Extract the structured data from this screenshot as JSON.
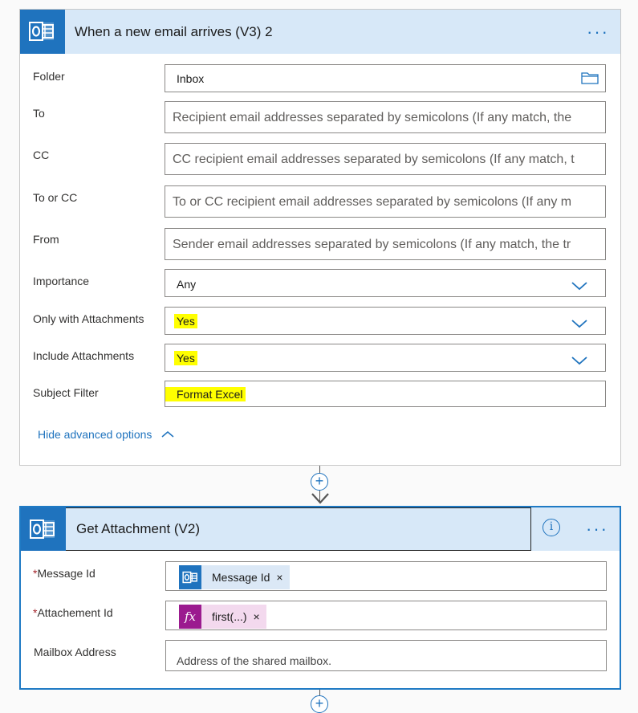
{
  "trigger": {
    "title": "When a new email arrives (V3) 2",
    "menu_dots": "···",
    "fields": [
      {
        "label": "Folder",
        "value": "Inbox",
        "kind": "value"
      },
      {
        "label": "To",
        "placeholder": "Recipient email addresses separated by semicolons (If any match, the"
      },
      {
        "label": "CC",
        "placeholder": "CC recipient email addresses separated by semicolons (If any match, t"
      },
      {
        "label": "To or CC",
        "placeholder": "To or CC recipient email addresses separated by semicolons (If any m"
      },
      {
        "label": "From",
        "placeholder": "Sender email addresses separated by semicolons (If any match, the tr"
      },
      {
        "label": "Importance",
        "value": "Any"
      },
      {
        "label": "Only with Attachments",
        "value": "Yes"
      },
      {
        "label": "Include Attachments",
        "value": "Yes"
      },
      {
        "label": "Subject Filter",
        "value": "Format Excel"
      }
    ],
    "hide_advanced": "Hide advanced options"
  },
  "connector": {
    "add_symbol": "+"
  },
  "action": {
    "title": "Get Attachment (V2)",
    "info_symbol": "i",
    "menu_dots": "···",
    "required_mark": "*",
    "fields": [
      {
        "label": "Message Id",
        "token": "Message Id"
      },
      {
        "label": "Attachement Id",
        "token": "first(...)",
        "token_icon": "fx"
      },
      {
        "label": "Mailbox Address",
        "placeholder": "Address of the shared mailbox."
      }
    ],
    "remove_symbol": "×"
  },
  "colors": {
    "accent": "#1f73be",
    "header_bg": "#d7e8f8",
    "highlight": "#ffff00",
    "fx_token": "#9b1b8f"
  }
}
